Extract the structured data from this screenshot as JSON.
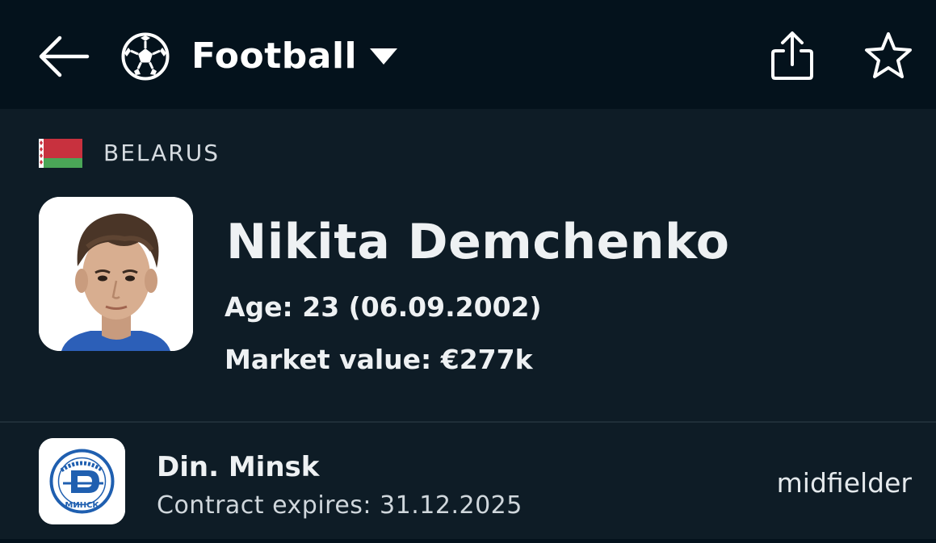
{
  "header": {
    "sport_label": "Football",
    "icons": {
      "back": "arrow-left-icon",
      "sport": "soccer-ball-icon",
      "dropdown": "caret-down-icon",
      "share": "share-icon",
      "favorite": "star-outline-icon"
    }
  },
  "player": {
    "country": "BELARUS",
    "name": "Nikita Demchenko",
    "age_line": "Age: 23 (06.09.2002)",
    "market_value_line": "Market value: €277k"
  },
  "club": {
    "name": "Din. Minsk",
    "contract_line": "Contract expires: 31.12.2025",
    "position": "midfielder",
    "logo_text": "МИНСК"
  },
  "colors": {
    "background": "#0e1c26",
    "topbar": "#04121c",
    "flag_red": "#c8313e",
    "flag_green": "#4aa657",
    "club_blue": "#1f5fb0"
  }
}
